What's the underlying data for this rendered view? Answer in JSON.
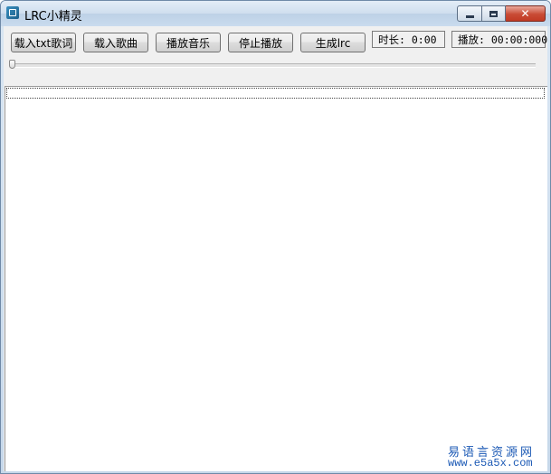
{
  "window": {
    "title": "LRC小精灵",
    "icon": "app-icon"
  },
  "toolbar": {
    "load_txt_label": "载入txt歌词",
    "load_song_label": "载入歌曲",
    "play_label": "播放音乐",
    "stop_label": "停止播放",
    "generate_label": "生成lrc",
    "duration_text": "时长: 0:00",
    "playback_text": "播放: 00:00:000"
  },
  "slider": {
    "position": 0
  },
  "watermark": {
    "name": "易语言资源网",
    "url": "www.e5a5x.com",
    "color": "#1b59b5"
  }
}
